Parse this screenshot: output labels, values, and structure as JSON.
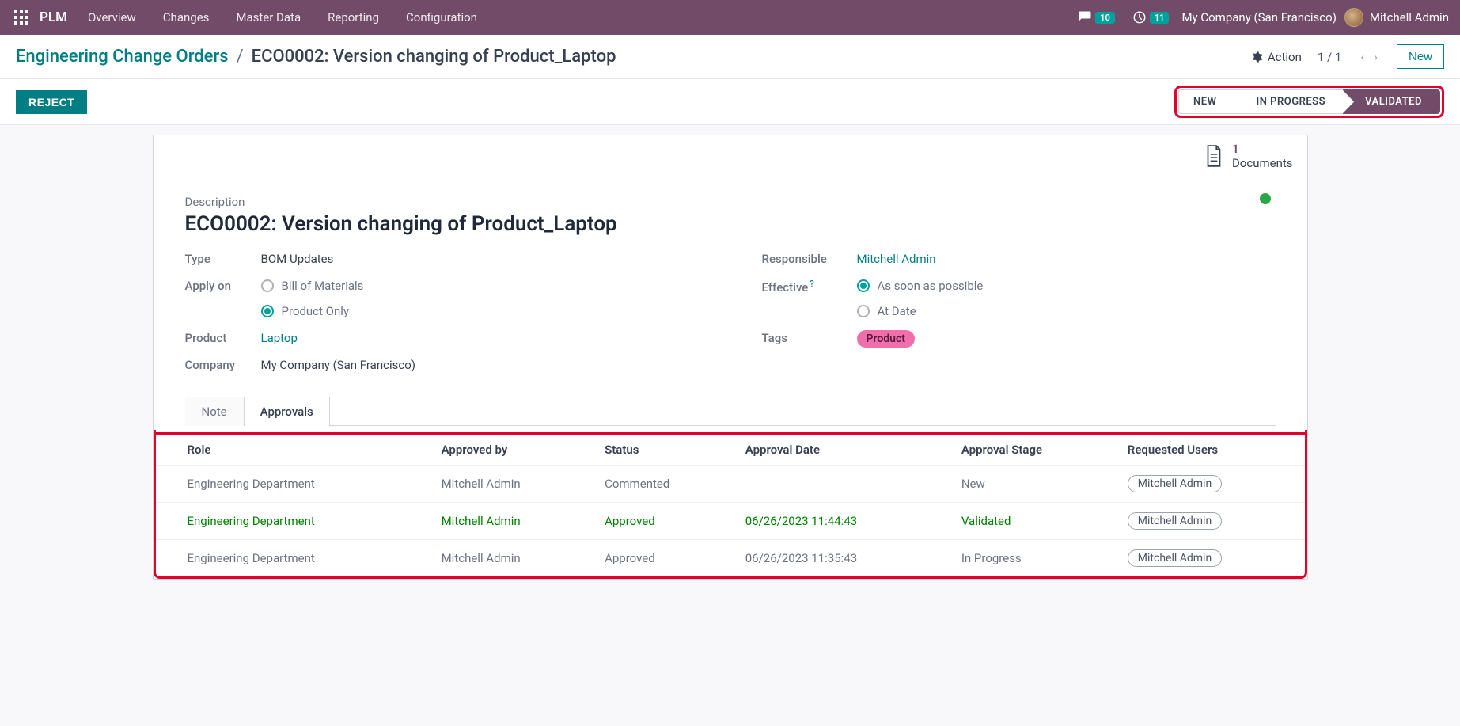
{
  "nav": {
    "brand": "PLM",
    "menu": [
      "Overview",
      "Changes",
      "Master Data",
      "Reporting",
      "Configuration"
    ],
    "messages_badge": "10",
    "activities_badge": "11",
    "company": "My Company (San Francisco)",
    "user": "Mitchell Admin"
  },
  "breadcrumb": {
    "root": "Engineering Change Orders",
    "current": "ECO0002: Version changing of Product_Laptop"
  },
  "controls": {
    "action_label": "Action",
    "pager": "1 / 1",
    "new_label": "New",
    "reject_label": "REJECT"
  },
  "status_steps": [
    "NEW",
    "IN PROGRESS",
    "VALIDATED"
  ],
  "stat_button": {
    "count": "1",
    "label": "Documents"
  },
  "form": {
    "desc_label": "Description",
    "title": "ECO0002: Version changing of Product_Laptop",
    "type_label": "Type",
    "type_value": "BOM Updates",
    "apply_label": "Apply on",
    "apply_options": [
      "Bill of Materials",
      "Product Only"
    ],
    "product_label": "Product",
    "product_value": "Laptop",
    "company_label": "Company",
    "company_value": "My Company (San Francisco)",
    "responsible_label": "Responsible",
    "responsible_value": "Mitchell Admin",
    "effective_label": "Effective",
    "effective_options": [
      "As soon as possible",
      "At Date"
    ],
    "tags_label": "Tags",
    "tags_value": "Product"
  },
  "tabs": [
    "Note",
    "Approvals"
  ],
  "table": {
    "headers": [
      "Role",
      "Approved by",
      "Status",
      "Approval Date",
      "Approval Stage",
      "Requested Users"
    ],
    "rows": [
      {
        "role": "Engineering Department",
        "by": "Mitchell Admin",
        "status": "Commented",
        "date": "",
        "stage": "New",
        "user": "Mitchell Admin",
        "green": false
      },
      {
        "role": "Engineering Department",
        "by": "Mitchell Admin",
        "status": "Approved",
        "date": "06/26/2023 11:44:43",
        "stage": "Validated",
        "user": "Mitchell Admin",
        "green": true
      },
      {
        "role": "Engineering Department",
        "by": "Mitchell Admin",
        "status": "Approved",
        "date": "06/26/2023 11:35:43",
        "stage": "In Progress",
        "user": "Mitchell Admin",
        "green": false
      }
    ]
  }
}
